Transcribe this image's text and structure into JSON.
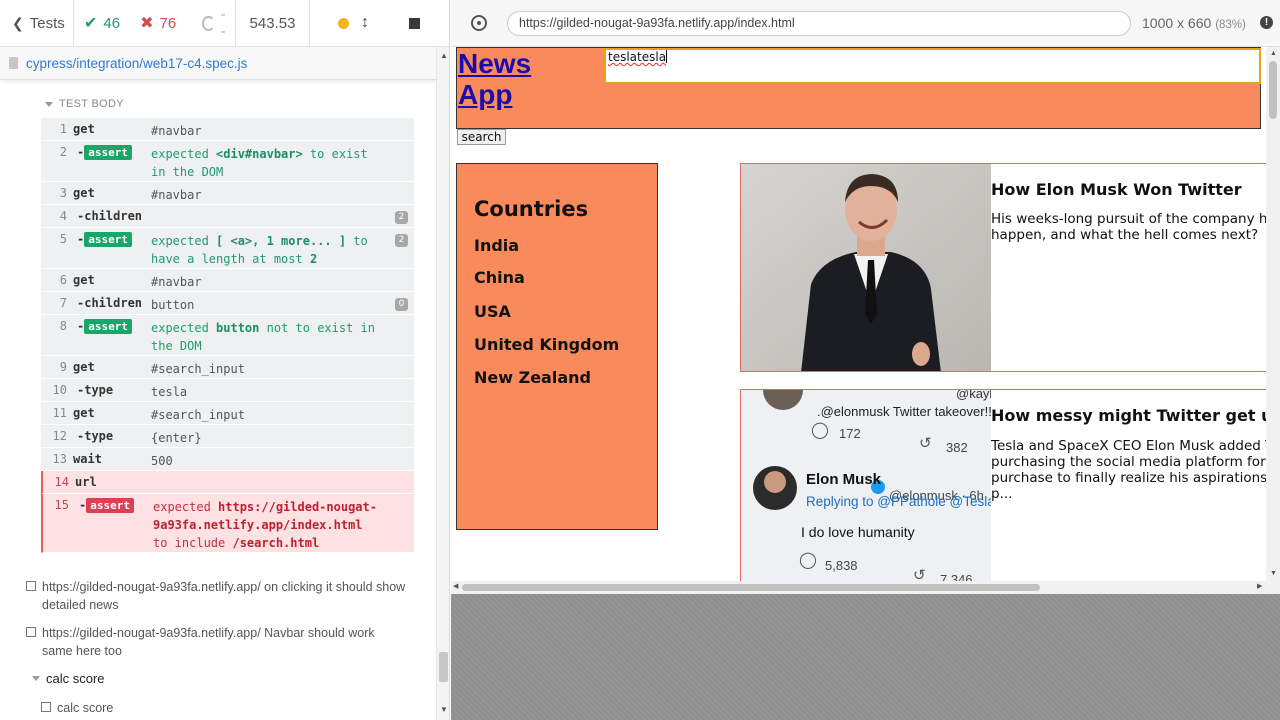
{
  "reporter": {
    "tests_label": "Tests",
    "passed": "46",
    "failed": "76",
    "pending": "--",
    "duration": "543.53",
    "spec_file": "cypress/integration/web17-c4.spec.js",
    "section_label": "TEST BODY",
    "commands": [
      {
        "n": "1",
        "name": "get",
        "msg": "#navbar"
      },
      {
        "n": "2",
        "name": "-assert",
        "pre": "expected ",
        "strong1": "<div#navbar>",
        "mid": " to exist in the DOM"
      },
      {
        "n": "3",
        "name": "get",
        "msg": "#navbar"
      },
      {
        "n": "4",
        "name": "-children",
        "msg": "",
        "badge": "2"
      },
      {
        "n": "5",
        "name": "-assert",
        "pre": "expected ",
        "strong1": "[ <a>, 1 more... ]",
        "mid": " to have a length at most ",
        "strong2": "2",
        "badge": "2"
      },
      {
        "n": "6",
        "name": "get",
        "msg": "#navbar"
      },
      {
        "n": "7",
        "name": "-children",
        "msg": "button",
        "badge": "0"
      },
      {
        "n": "8",
        "name": "-assert",
        "pre": "expected ",
        "strong1": "button",
        "mid": " not to exist in the DOM"
      },
      {
        "n": "9",
        "name": "get",
        "msg": "#search_input"
      },
      {
        "n": "10",
        "name": "-type",
        "msg": "tesla"
      },
      {
        "n": "11",
        "name": "get",
        "msg": "#search_input"
      },
      {
        "n": "12",
        "name": "-type",
        "msg": "{enter}"
      },
      {
        "n": "13",
        "name": "wait",
        "msg": "500"
      },
      {
        "n": "14",
        "name": "url",
        "msg": ""
      },
      {
        "n": "15",
        "name": "-assert",
        "pre": "expected ",
        "strong1": "https://gilded-nougat-9a93fa.netlify.app/index.html",
        "mid": " to include ",
        "strong2": "/search.html"
      }
    ],
    "tests": [
      "https://gilded-nougat-9a93fa.netlify.app/ on clicking it should show detailed news",
      "https://gilded-nougat-9a93fa.netlify.app/ Navbar should work same here too"
    ],
    "suite": "calc score",
    "suite_test": "calc score"
  },
  "browser": {
    "url": "https://gilded-nougat-9a93fa.netlify.app/index.html",
    "viewport": "1000 x 660",
    "zoom": "(83%)"
  },
  "app": {
    "brand_line1": "News",
    "brand_line2": "App",
    "search_value_a": "tesla",
    "search_value_b": "tesla",
    "search_button": "search",
    "countries_title": "Countries",
    "countries": [
      "India",
      "China",
      "USA",
      "United Kingdom",
      "New Zealand"
    ],
    "news": [
      {
        "title": "How Elon Musk Won Twitter",
        "desc": "His weeks-long pursuit of the company ha\nhappen, and what the hell comes next?"
      },
      {
        "title": "How messy might Twitter get ur",
        "desc": "Tesla and SpaceX CEO Elon Musk added T\npurchasing the social media platform for $\npurchase to finally realize his aspirations a\np..."
      }
    ],
    "tweet": {
      "handle_top": "@kayle",
      "mention": ".@elonmusk Twitter takeover!!",
      "count1": "172",
      "count2": "382",
      "author": "Elon Musk",
      "author_handle": "@elonmusk · 6h",
      "reply": "Replying to @PPathole @Tesla ar",
      "text": "I do love humanity",
      "count3": "5,838",
      "count4": "7,346"
    }
  },
  "colors": {
    "accent_orange": "#f88a5b",
    "pass_green": "#1f9c6e",
    "fail_red": "#d14d4d",
    "link_blue": "#1a0dab"
  }
}
